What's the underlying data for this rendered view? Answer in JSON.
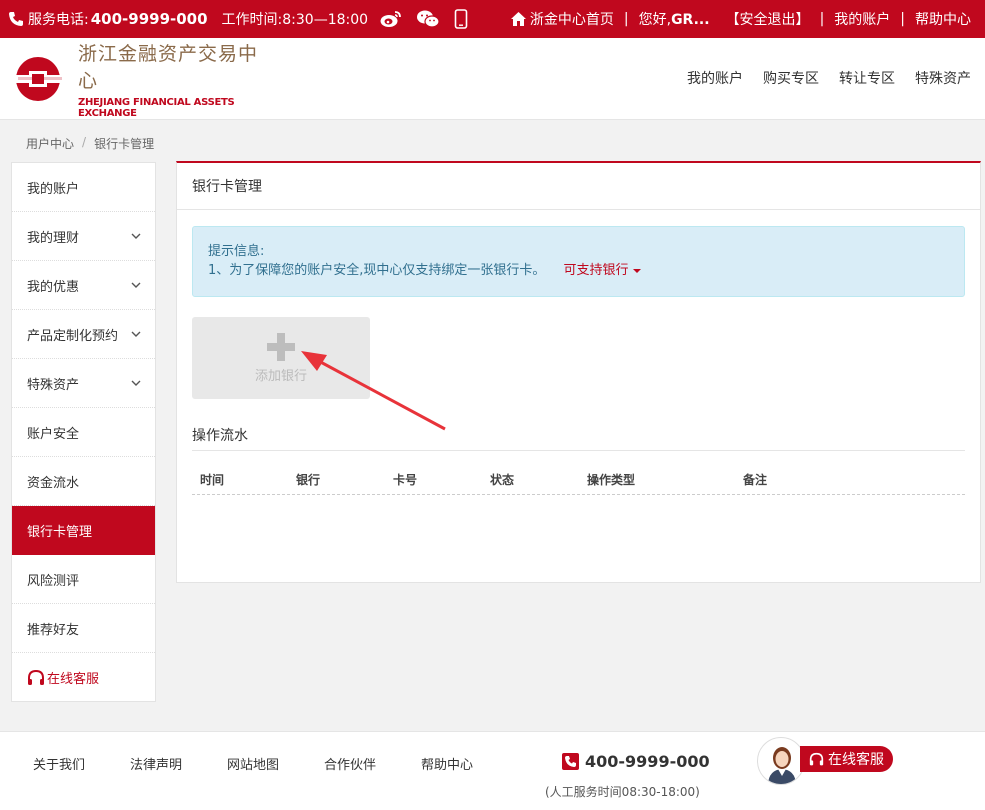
{
  "topbar": {
    "phone_label": "服务电话:",
    "phone_number": "400-9999-000",
    "worktime": "工作时间:8:30—18:00",
    "home_link": "浙金中心首页",
    "greeting_prefix": "您好,",
    "greeting_user": "GR...",
    "logout": "【安全退出】",
    "my_account": "我的账户",
    "help": "帮助中心",
    "social_icons": [
      "weibo-icon",
      "wechat-icon",
      "mobile-icon"
    ]
  },
  "header": {
    "logo_cn": "浙江金融资产交易中心",
    "logo_en": "ZHEJIANG FINANCIAL ASSETS EXCHANGE",
    "nav": [
      "我的账户",
      "购买专区",
      "转让专区",
      "特殊资产"
    ]
  },
  "breadcrumb": [
    "用户中心",
    "/",
    "银行卡管理"
  ],
  "sidebar": {
    "items": [
      {
        "label": "我的账户",
        "expandable": false
      },
      {
        "label": "我的理财",
        "expandable": true
      },
      {
        "label": "我的优惠",
        "expandable": true
      },
      {
        "label": "产品定制化预约",
        "expandable": true
      },
      {
        "label": "特殊资产",
        "expandable": true
      },
      {
        "label": "账户安全",
        "expandable": false
      },
      {
        "label": "资金流水",
        "expandable": false
      },
      {
        "label": "银行卡管理",
        "expandable": false,
        "active": true
      },
      {
        "label": "风险测评",
        "expandable": false
      },
      {
        "label": "推荐好友",
        "expandable": false
      }
    ],
    "service": "在线客服"
  },
  "main": {
    "title": "银行卡管理",
    "alert_title": "提示信息:",
    "alert_text": "1、为了保障您的账户安全,现中心仅支持绑定一张银行卡。",
    "alert_link": "可支持银行",
    "add_bank": "添加银行",
    "flow_title": "操作流水",
    "table_headers": [
      "时间",
      "银行",
      "卡号",
      "状态",
      "操作类型",
      "备注"
    ]
  },
  "footer": {
    "links": [
      "关于我们",
      "法律声明",
      "网站地图",
      "合作伙伴",
      "帮助中心"
    ],
    "phone": "400-9999-000",
    "service_hours": "(人工服务时间08:30-18:00)",
    "service_button": "在线客服"
  },
  "colors": {
    "brand": "#c0081e",
    "alert_bg": "#d9edf7",
    "alert_text": "#31708f"
  }
}
